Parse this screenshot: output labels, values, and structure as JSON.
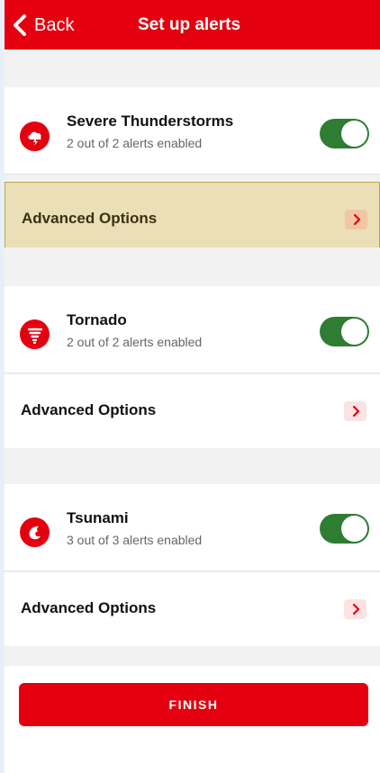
{
  "nav": {
    "back_label": "Back",
    "title": "Set up alerts"
  },
  "alerts": [
    {
      "title": "Severe Thunderstorms",
      "status": "2 out of 2 alerts enabled",
      "enabled": true,
      "icon": "thunderstorm-cloud-icon",
      "advanced_label": "Advanced Options",
      "advanced_highlighted": true
    },
    {
      "title": "Tornado",
      "status": "2 out of 2 alerts enabled",
      "enabled": true,
      "icon": "tornado-icon",
      "advanced_label": "Advanced Options",
      "advanced_highlighted": false
    },
    {
      "title": "Tsunami",
      "status": "3 out of 3 alerts enabled",
      "enabled": true,
      "icon": "tsunami-wave-icon",
      "advanced_label": "Advanced Options",
      "advanced_highlighted": false
    }
  ],
  "finish_label": "FINISH",
  "colors": {
    "brand_red": "#e4000f",
    "toggle_on": "#2e7d32",
    "highlight_bg": "#ebdfb7",
    "highlight_border": "#c2a44e"
  }
}
